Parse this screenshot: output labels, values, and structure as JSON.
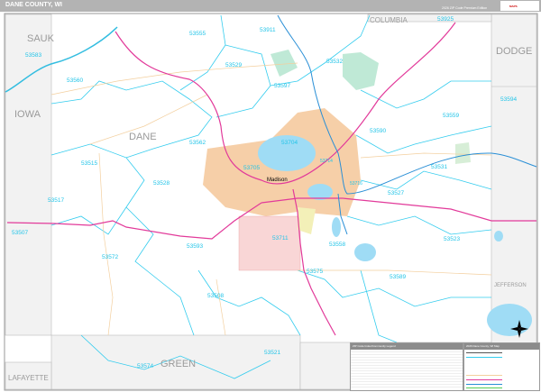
{
  "header": {
    "title": "DANE COUNTY, WI",
    "edition": "2026 ZIP Code Premium Edition",
    "logo_text": "Market MAPS"
  },
  "counties": {
    "main": "DANE",
    "neighbors": [
      "SAUK",
      "COLUMBIA",
      "DODGE",
      "IOWA",
      "JEFFERSON",
      "LAFAYETTE",
      "GREEN"
    ]
  },
  "cities": {
    "capital": "Madison"
  },
  "zip_codes": [
    "53911",
    "53925",
    "53555",
    "53529",
    "53532",
    "53583",
    "53560",
    "53597",
    "53594",
    "53559",
    "53562",
    "53590",
    "53515",
    "53528",
    "53705",
    "53704",
    "53531",
    "53527",
    "53517",
    "53507",
    "53572",
    "53593",
    "53711",
    "53558",
    "53523",
    "53575",
    "53589",
    "53508",
    "53521",
    "53574",
    "53716",
    "53714"
  ],
  "legend": {
    "table_title": "ZIP Code Index/Community Legend",
    "key_title": "2026 Dane County, WI Map"
  },
  "colors": {
    "zip_boundary": "#33ccee",
    "interstate": "#e23a9a",
    "us_highway": "#2a8fd6",
    "water": "#9fdcf5",
    "urban": "#f6cfa8",
    "neighbor": "#f2f2f2"
  }
}
